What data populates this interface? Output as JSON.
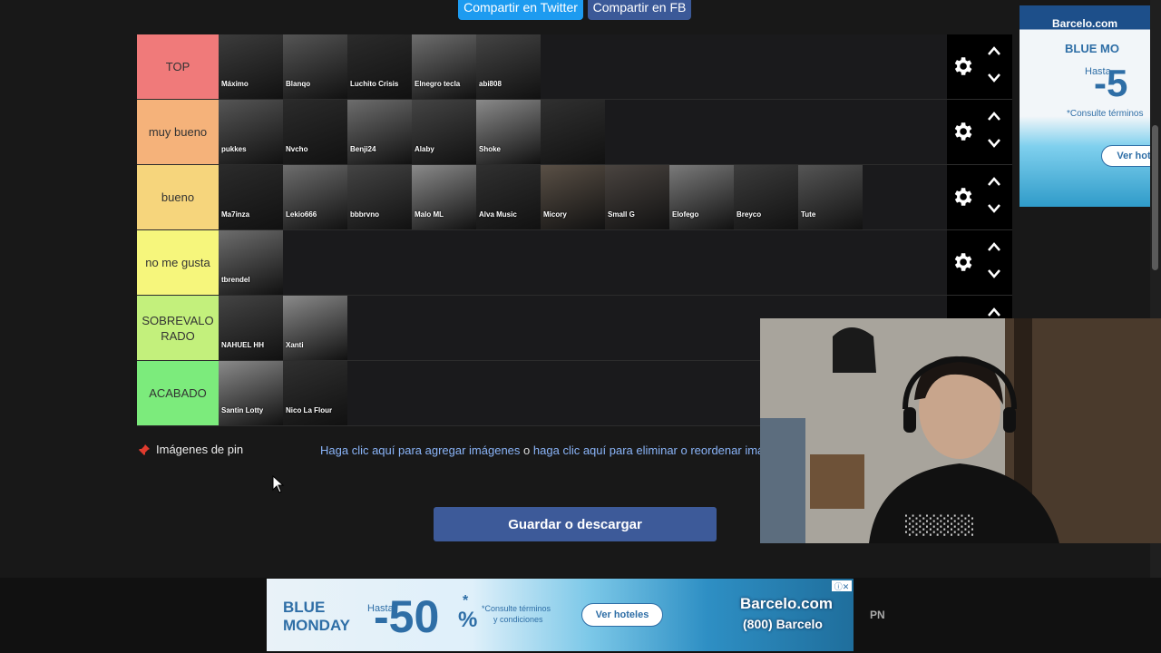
{
  "share": {
    "twitter_label": "Compartir en Twitter",
    "fb_label": "Compartir en FB"
  },
  "tiers": [
    {
      "label": "TOP",
      "color": "#f07a7a",
      "items": [
        "Máximo",
        "Blanqo",
        "Luchito Crisis",
        "Elnegro tecla",
        "abi808"
      ]
    },
    {
      "label": "muy bueno",
      "color": "#f5b27a",
      "items": [
        "pukkes",
        "Nvcho",
        "Benji24",
        "Alaby",
        "Shoke",
        ""
      ]
    },
    {
      "label": "bueno",
      "color": "#f6d57c",
      "items": [
        "Ma7inza",
        "Lekio666",
        "bbbrvno",
        "Malo ML",
        "Alva Music",
        "Micory",
        "Small G",
        "Elofego",
        "Breyco",
        "Tute"
      ]
    },
    {
      "label": "no me gusta",
      "color": "#f6f67c",
      "items": [
        "tbrendel"
      ]
    },
    {
      "label": "SOBREVALO RADO",
      "color": "#c3f07c",
      "items": [
        "NAHUEL HH",
        "Xanti"
      ]
    },
    {
      "label": "ACABADO",
      "color": "#7ceb7c",
      "items": [
        "Santin Lotty",
        "Nico La Flour"
      ]
    }
  ],
  "pin": {
    "label": "Imágenes de pin"
  },
  "links": {
    "add_images": "Haga clic aquí para agregar imágenes",
    "or": "o",
    "remove_images": "haga clic aquí para eliminar o reordenar imá"
  },
  "save_button": "Guardar o descargar",
  "ad_side": {
    "brand": "Barcelo.com",
    "headline": "BLUE MO",
    "hasta": "Hasta",
    "discount": "-5",
    "terms": "*Consulte términos",
    "cta": "Ver hot"
  },
  "ad_bottom": {
    "headline_1": "BLUE",
    "headline_2": "MONDAY",
    "hasta": "Hasta",
    "discount": "-50",
    "percent": "%",
    "asterisk": "*",
    "terms_1": "*Consulte términos",
    "terms_2": "y condiciones",
    "cta": "Ver hoteles",
    "brand": "Barcelo.com",
    "phone": "(800) Barcelo"
  },
  "pn_label": "PN",
  "icons": {
    "gear": "gear-icon",
    "up": "chevron-up-icon",
    "down": "chevron-down-icon",
    "pin": "pushpin-icon"
  },
  "colors": {
    "share_twitter": "#1d9bf0",
    "share_fb": "#3b5998",
    "save": "#3d5a99",
    "link": "#8ab4f8"
  }
}
